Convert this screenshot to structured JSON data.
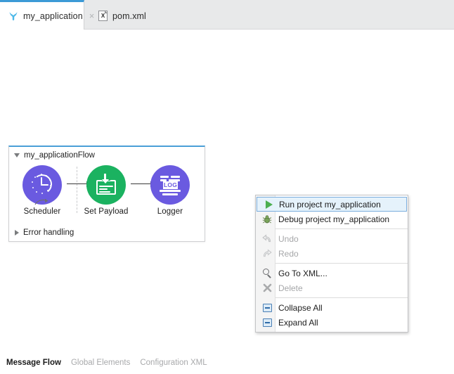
{
  "tabs": [
    {
      "label": "my_application",
      "icon": "mule-icon",
      "close": "×",
      "active": true
    },
    {
      "label": "pom.xml",
      "icon": "xml-file-icon",
      "badge": "X",
      "active": false
    }
  ],
  "flow": {
    "title": "my_applicationFlow",
    "error_handling": "Error handling",
    "nodes": [
      {
        "label": "Scheduler",
        "icon": "clock-icon",
        "color": "#6a5ae0"
      },
      {
        "label": "Set Payload",
        "icon": "set-payload-icon",
        "color": "#1bb260"
      },
      {
        "label": "Logger",
        "icon": "log-icon",
        "color": "#6a5ae0",
        "glyph": "LOG"
      }
    ]
  },
  "context_menu": {
    "items": [
      {
        "label": "Run project my_application",
        "icon": "run-icon",
        "enabled": true,
        "selected": true,
        "separator_after": false
      },
      {
        "label": "Debug project my_application",
        "icon": "debug-bug-icon",
        "enabled": true,
        "selected": false,
        "separator_after": true
      },
      {
        "label": "Undo",
        "icon": "undo-arrow-icon",
        "enabled": false,
        "selected": false,
        "separator_after": false
      },
      {
        "label": "Redo",
        "icon": "redo-arrow-icon",
        "enabled": false,
        "selected": false,
        "separator_after": true
      },
      {
        "label": "Go To XML...",
        "icon": "search-icon",
        "enabled": true,
        "selected": false,
        "separator_after": false
      },
      {
        "label": "Delete",
        "icon": "delete-x-icon",
        "enabled": false,
        "selected": false,
        "separator_after": true
      },
      {
        "label": "Collapse All",
        "icon": "collapse-doc-icon",
        "enabled": true,
        "selected": false,
        "separator_after": false
      },
      {
        "label": "Expand All",
        "icon": "expand-doc-icon",
        "enabled": true,
        "selected": false,
        "separator_after": false
      }
    ]
  },
  "bottom_tabs": [
    {
      "label": "Message Flow",
      "active": true
    },
    {
      "label": "Global Elements",
      "active": false
    },
    {
      "label": "Configuration XML",
      "active": false
    }
  ],
  "colors": {
    "accent_blue": "#3c9ad6",
    "node_purple": "#6a5ae0",
    "node_green": "#1bb260",
    "selection_bg": "#e5f2fb",
    "selection_border": "#7aaddd"
  }
}
